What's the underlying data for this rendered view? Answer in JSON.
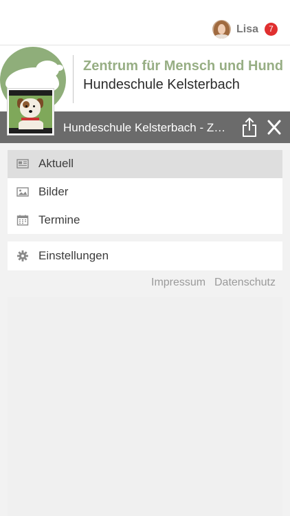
{
  "user": {
    "name": "Lisa",
    "notification_count": "7"
  },
  "banner": {
    "line1": "Zentrum für Mensch und Hund",
    "line2": "Hundeschule Kelsterbach"
  },
  "header": {
    "title": "Hundeschule Kelsterbach - Zentrum für Mensch und Hund"
  },
  "menu": {
    "items": [
      {
        "label": "Aktuell",
        "icon": "newspaper-icon",
        "active": true
      },
      {
        "label": "Bilder",
        "icon": "image-icon",
        "active": false
      },
      {
        "label": "Termine",
        "icon": "calendar-icon",
        "active": false
      }
    ],
    "settings": {
      "label": "Einstellungen",
      "icon": "gear-icon"
    }
  },
  "footer": {
    "impressum": "Impressum",
    "datenschutz": "Datenschutz"
  },
  "colors": {
    "brand_green": "#97ae84",
    "header_bar": "#6b6b6b",
    "badge_red": "#e02f2f",
    "active_row": "#dedede"
  }
}
